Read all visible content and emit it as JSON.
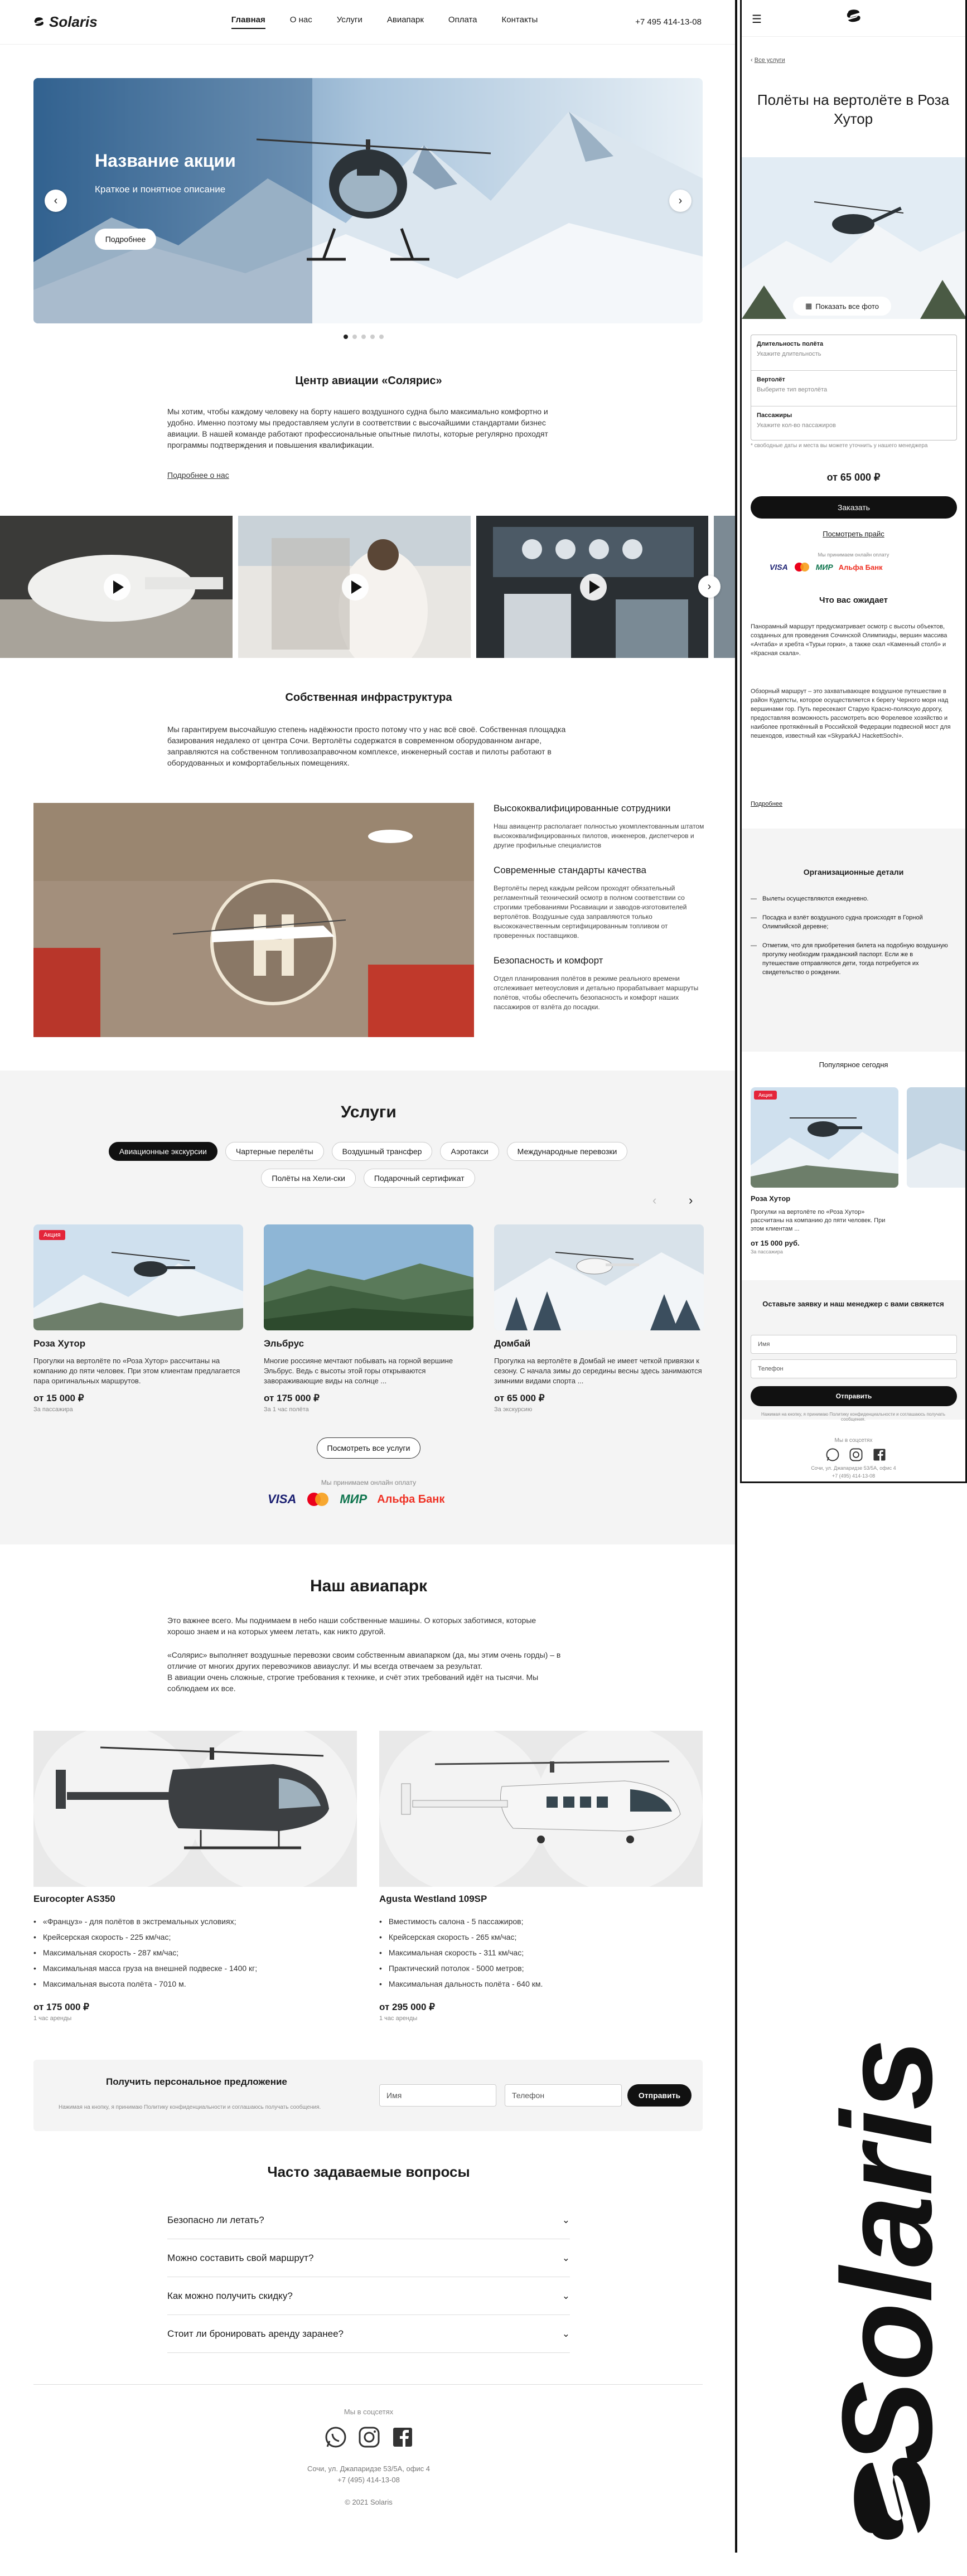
{
  "brand": "Solaris",
  "nav": [
    "Главная",
    "О нас",
    "Услуги",
    "Авиапарк",
    "Оплата",
    "Контакты"
  ],
  "phone": "+7 495 414-13-08",
  "hero": {
    "title": "Название акции",
    "subtitle": "Краткое и понятное описание",
    "button": "Подробнее"
  },
  "about": {
    "title": "Центр авиации «Солярис»",
    "text": "Мы хотим, чтобы каждому человеку на борту нашего воздушного судна было максимально комфортно и удобно. Именно поэтому мы предоставляем услуги в соответствии с высочайшими стандартами бизнес авиации. В нашей команде работают профессиональные опытные пилоты, которые регулярно проходят программы подтверждения и повышения квалификации.",
    "link": "Подробнее о нас"
  },
  "infra": {
    "title": "Собственная инфраструктура",
    "text": "Мы гарантируем высочайшую степень надёжности просто потому что у нас всё своё. Собственная площадка базирования недалеко от центра Сочи. Вертолёты содержатся в современном оборудованном ангаре, заправляются на собственном топливозаправочном комплексе, инженерный состав и пилоты работают в оборудованных и комфортабельных помещениях.",
    "features": [
      {
        "title": "Высококвалифицированные сотрудники",
        "text": "Наш авиацентр располагает полностью укомплектованным штатом высококвалифицированных пилотов, инженеров, диспетчеров и другие профильные специалистов"
      },
      {
        "title": "Современные стандарты качества",
        "text": "Вертолёты перед каждым рейсом проходят обязательный регламентный технический осмотр в полном соответствии со строгими требованиями Росавиации и заводов-изготовителей вертолётов. Воздушные суда заправляются только высококачественным сертифицированным топливом от проверенных поставщиков."
      },
      {
        "title": "Безопасность и комфорт",
        "text": "Отдел планирования полётов в режиме реального времени отслеживает метеоусловия и детально прорабатывает маршруты полётов, чтобы обеспечить безопасность и комфорт наших пассажиров от взлёта до посадки."
      }
    ]
  },
  "services": {
    "title": "Услуги",
    "tabs": [
      "Авиационные экскурсии",
      "Чартерные перелёты",
      "Воздушный трансфер",
      "Аэротакси",
      "Международные перевозки",
      "Полёты на Хели-ски",
      "Подарочный сертификат"
    ],
    "cards": [
      {
        "badge": "Акция",
        "title": "Роза Хутор",
        "text": "Прогулки на вертолёте по «Роза Хутор» рассчитаны на компанию до пяти человек. При этом клиентам предлагается пара оригинальных маршрутов.",
        "price": "от 15 000 ₽",
        "note": "За пассажира"
      },
      {
        "title": "Эльбрус",
        "text": "Многие россияне мечтают побывать на горной вершине Эльбрус. Ведь с высоты этой горы открываются завораживающие виды на солнце ...",
        "price": "от 175 000 ₽",
        "note": "За 1 час полёта"
      },
      {
        "title": "Домбай",
        "text": "Прогулка на вертолёте в Домбай не имеет четкой привязки к сезону. С начала зимы до середины весны здесь занимаются зимними видами спорта ...",
        "price": "от 65 000 ₽",
        "note": "За экскурсию"
      }
    ],
    "all_button": "Посмотреть все услуги",
    "payment_note": "Мы принимаем онлайн оплату",
    "payment_logos": [
      "VISA",
      "МИР",
      "Альфа Банк"
    ]
  },
  "fleet": {
    "title": "Наш авиапарк",
    "text1": "Это важнее всего. Мы поднимаем в небо наши собственные машины. О которых заботимся, которые хорошо знаем и на которых умеем летать, как никто другой.",
    "text2": "«Солярис» выполняет воздушные перевозки своим собственным авиапарком (да, мы этим очень горды) – в отличие от многих других перевозчиков авиауслуг. И мы всегда отвечаем за результат.",
    "text3": "В авиации очень сложные, строгие требования к технике, и счёт этих требований идёт на тысячи. Мы соблюдаем их все.",
    "items": [
      {
        "name": "Eurocopter AS350",
        "specs": [
          "«Француз» - для полётов в экстремальных условиях;",
          "Крейсерская скорость - 225 км/час;",
          "Максимальная скорость - 287 км/час;",
          "Максимальная масса груза на внешней подвеске - 1400 кг;",
          "Максимальная высота полёта - 7010 м."
        ],
        "price": "от 175 000 ₽",
        "note": "1 час аренды"
      },
      {
        "name": "Agusta Westland 109SP",
        "specs": [
          "Вместимость салона - 5 пассажиров;",
          "Крейсерская скорость - 265 км/час;",
          "Максимальная скорость - 311 км/час;",
          "Практический потолок - 5000 метров;",
          "Максимальная дальность полёта - 640 км."
        ],
        "price": "от 295 000 ₽",
        "note": "1 час аренды"
      }
    ]
  },
  "offer": {
    "title": "Получить персональное предложение",
    "consent": "Нажимая на кнопку, я принимаю Политику конфиденциальности и соглашаюсь получать сообщения.",
    "name_ph": "Имя",
    "phone_ph": "Телефон",
    "button": "Отправить"
  },
  "faq": {
    "title": "Часто задаваемые вопросы",
    "items": [
      "Безопасно ли летать?",
      "Можно составить свой маршрут?",
      "Как можно получить скидку?",
      "Стоит ли бронировать аренду заранее?"
    ]
  },
  "footer": {
    "social": "Мы в соцсетях",
    "address": "Сочи, ул. Джапаридзе 53/5А, офис 4",
    "phone": "+7 (495) 414-13-08",
    "copy": "© 2021 Solaris"
  },
  "mobile": {
    "back": "Все услуги",
    "title": "Полёты на вертолёте в Роза Хутор",
    "photos_btn": "Показать все фото",
    "fields": [
      {
        "label": "Длительность полёта",
        "ph": "Укажите длительность"
      },
      {
        "label": "Вертолёт",
        "ph": "Выберите тип вертолёта"
      },
      {
        "label": "Пассажиры",
        "ph": "Укажите кол-во пассажиров"
      }
    ],
    "field_note": "* свободные даты и места вы можете уточнить у нашего менеджера",
    "price": "от 65 000 ₽",
    "order": "Заказать",
    "price_link": "Посмотреть прайс",
    "payment_note": "Мы принимаем онлайн оплату",
    "expect_title": "Что вас ожидает",
    "expect1": "Панорамный маршрут предусматривает осмотр с высоты объектов, созданных для проведения Сочинской Олимпиады, вершин массива «Ачтаба» и хребта «Турьи горки», а также скал «Каменный столб» и «Красная скала».",
    "expect2": "Обзорный маршрут – это захватывающее воздушное путешествие в район Кудепсты, которое осуществляется к берегу Черного моря над вершинами гор. Путь пересекают Старую Красно-поляскую дорогу, предоставляя возможность рассмотреть всю Форелевое хозяйство и наиболее протяжённый в Российской Федерации подвесной мост для пешеходов, известный как «SkyparkAJ HackettSochi».",
    "more": "Подробнее",
    "org_title": "Организационные детали",
    "org": [
      "Вылеты осуществляются ежедневно.",
      "Посадка и взлёт воздушного судна происходят в Горной Олимпийской деревне;",
      "Отметим, что для приобретения билета на подобную воздушную прогулку необходим гражданский паспорт. Если же в путешествие отправляются дети, тогда потребуется их свидетельство о рождении."
    ],
    "popular_title": "Популярное сегодня",
    "popular": {
      "badge": "Акция",
      "title": "Роза Хутор",
      "text": "Прогулки на вертолёте по «Роза Хутор» рассчитаны на компанию до пяти человек. При этом клиентам ...",
      "price": "от 15 000 руб.",
      "note": "За пассажира"
    },
    "form_title": "Оставьте заявку и наш менеджер с вами свяжется",
    "name_ph": "Имя",
    "phone_ph": "Телефон",
    "button": "Отправить",
    "consent": "Нажимая на кнопку, я принимаю Политику конфиденциальности и соглашаюсь получать сообщения."
  }
}
